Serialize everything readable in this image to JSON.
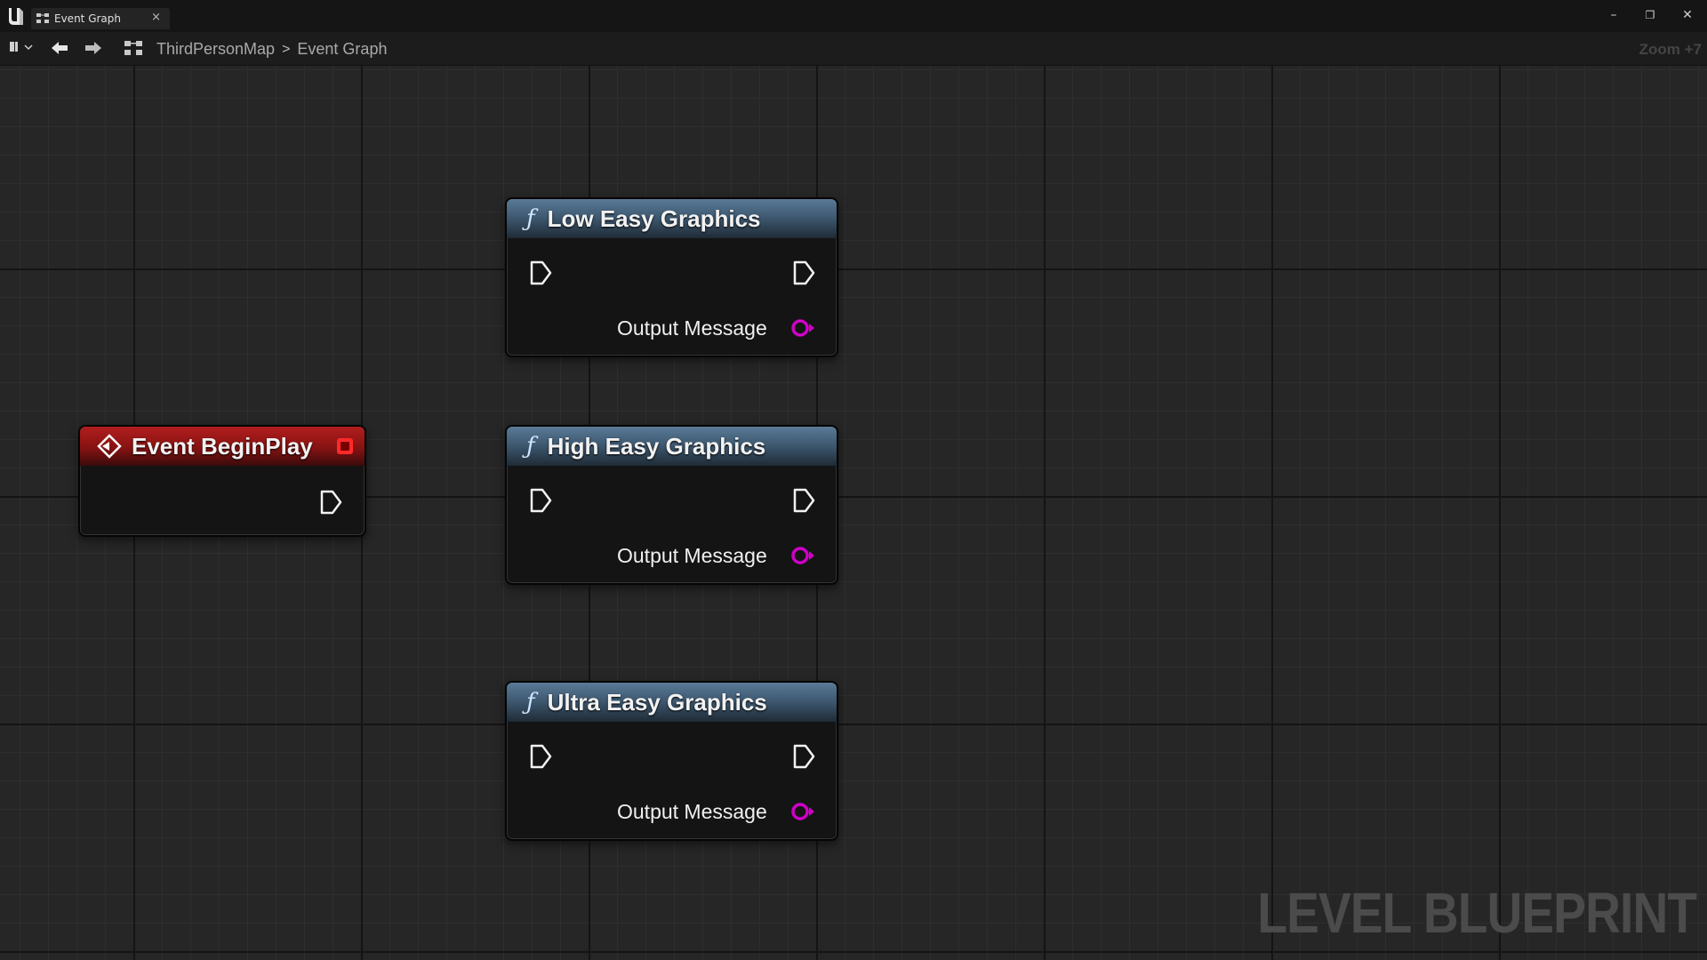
{
  "tab": {
    "label": "Event Graph",
    "close": "×"
  },
  "window": {
    "minimize": "–",
    "restore": "❐",
    "close": "✕"
  },
  "toolbar": {
    "back": "🡐",
    "forward": "🡒"
  },
  "breadcrumb": {
    "root": "ThirdPersonMap",
    "separator": ">",
    "current": "Event Graph"
  },
  "zoom": "Zoom +7",
  "watermark": "LEVEL BLUEPRINT",
  "nodes": {
    "event": {
      "title": "Event BeginPlay",
      "color": "#a51515"
    },
    "low": {
      "title": "Low Easy Graphics",
      "output": "Output Message",
      "icon": "ƒ"
    },
    "high": {
      "title": "High Easy Graphics",
      "output": "Output Message",
      "icon": "ƒ"
    },
    "ultra": {
      "title": "Ultra Easy Graphics",
      "output": "Output Message",
      "icon": "ƒ"
    }
  },
  "colors": {
    "string_pin": "#d000c8",
    "function_header": "#4a6a86",
    "event_header": "#a51515",
    "canvas": "#262626"
  }
}
